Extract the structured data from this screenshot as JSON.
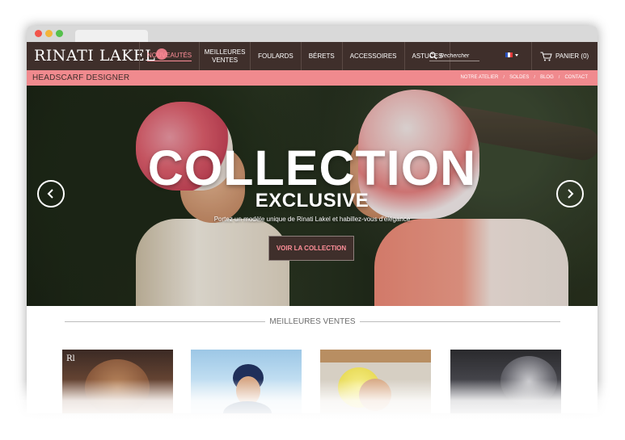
{
  "nav": {
    "logo": "RINATI LAKEL",
    "items": [
      {
        "label": "Nouveautés",
        "active": true
      },
      {
        "label": "Meilleures ventes",
        "active": false
      },
      {
        "label": "Foulards",
        "active": false
      },
      {
        "label": "Bérets",
        "active": false
      },
      {
        "label": "Accessoires",
        "active": false
      },
      {
        "label": "Astuces",
        "active": false
      }
    ],
    "search_placeholder": "Rechercher",
    "language_icon": "french-flag-icon",
    "cart_label": "PANIER (0)"
  },
  "subbar": {
    "tagline": "HEADSCARF DESIGNER",
    "links": [
      "NOTRE ATELIER",
      "SOLDES",
      "BLOG",
      "CONTACT"
    ]
  },
  "hero": {
    "title": "COLLECTION",
    "subtitle": "EXCLUSIVE",
    "text": "Portez un modèle unique de Rinati Lakel et habillez-vous d'élégance",
    "button": "VOIR LA COLLECTION"
  },
  "best_sellers": {
    "title": "MEILLEURES VENTES",
    "brand_tag": "Rl"
  },
  "colors": {
    "nav_bg": "#3f2f2b",
    "accent_pink": "#f08a8e",
    "active_link": "#ff8f99"
  }
}
